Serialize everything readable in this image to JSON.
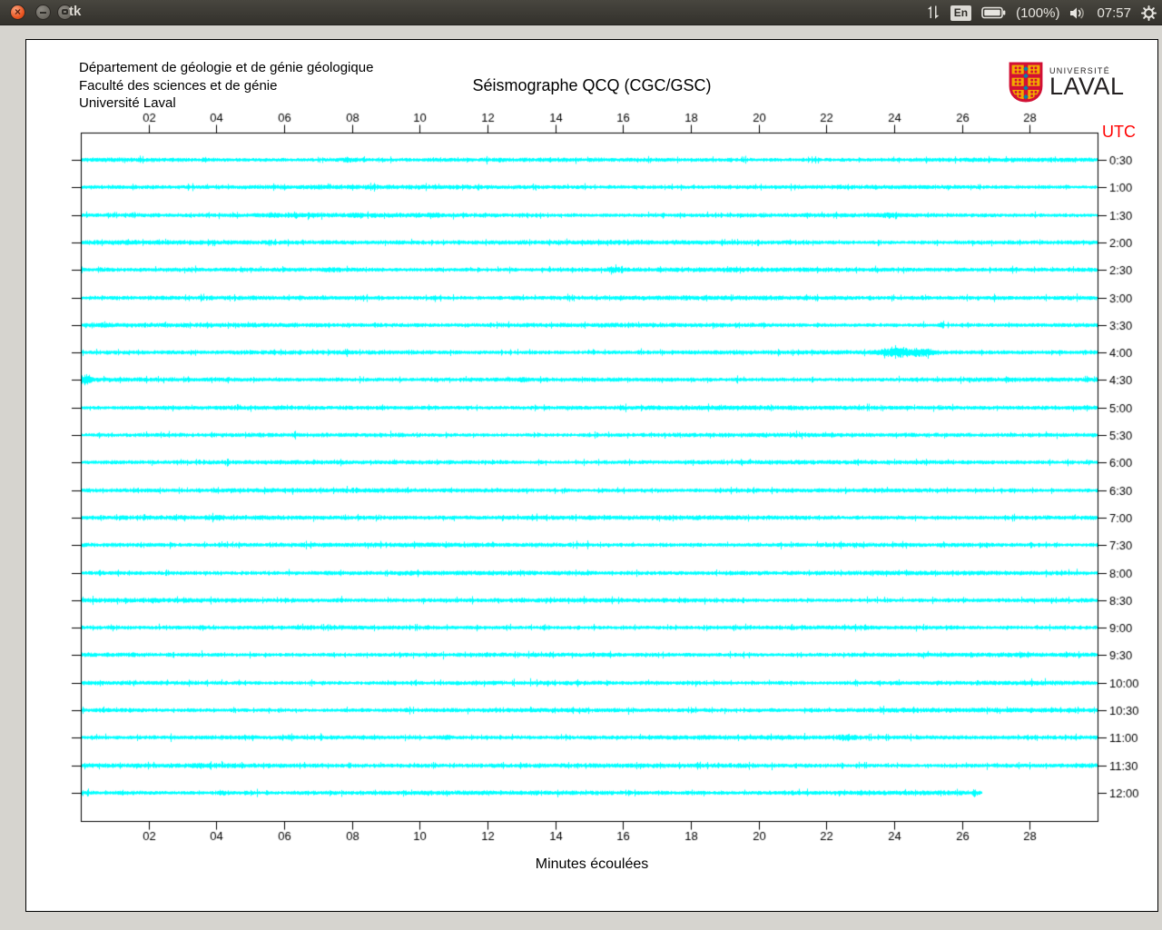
{
  "topbar": {
    "window_title": "tk",
    "window_buttons": {
      "close_glyph": "×"
    },
    "keyboard_layout": "En",
    "battery_percent": "(100%)",
    "clock": "07:57",
    "icons": {
      "network": "updown-arrows-icon",
      "battery": "battery-full-icon",
      "volume": "speaker-on-icon",
      "session": "gear-icon"
    }
  },
  "window": {
    "header_lines": [
      "Département de géologie et de génie géologique",
      "Faculté des sciences et de génie",
      "Université Laval"
    ],
    "title": "Séismographe QCQ (CGC/GSC)",
    "logo": {
      "line1": "UNIVERSITÉ",
      "line2": "LAVAL"
    },
    "utc_label": "UTC",
    "xlabel": "Minutes écoulées"
  },
  "colors": {
    "trace": "#00ffff",
    "utc_label": "#ff0000",
    "axis": "#000000",
    "close_button": "#e95420",
    "logo_red": "#d21034",
    "logo_gold": "#f2a900",
    "logo_blue": "#0085ad",
    "topbar_bg": "#3c3a35",
    "desktop_bg": "#d6d4cf"
  },
  "chart_data": {
    "type": "line",
    "title": "Séismographe QCQ (CGC/GSC)",
    "xlabel": "Minutes écoulées",
    "ylabel_right": "UTC",
    "x_range_minutes": [
      0,
      30
    ],
    "x_ticks": [
      "02",
      "04",
      "06",
      "08",
      "10",
      "12",
      "14",
      "16",
      "18",
      "20",
      "22",
      "24",
      "26",
      "28"
    ],
    "x_tick_minutes": [
      2,
      4,
      6,
      8,
      10,
      12,
      14,
      16,
      18,
      20,
      22,
      24,
      26,
      28
    ],
    "row_interval_minutes": 30,
    "trace_color": "#00ffff",
    "grid": false,
    "rows": [
      {
        "label": "0:30",
        "length_min": 30,
        "events": [
          {
            "min": 7.9,
            "width": 0.5,
            "amp": 1.6
          }
        ]
      },
      {
        "label": "1:00",
        "length_min": 30,
        "events": []
      },
      {
        "label": "1:30",
        "length_min": 30,
        "events": [
          {
            "min": 5.7,
            "width": 0.3,
            "amp": 1.2
          },
          {
            "min": 8.1,
            "width": 0.3,
            "amp": 1.3
          },
          {
            "min": 10.4,
            "width": 0.25,
            "amp": 1.5
          },
          {
            "min": 23.8,
            "width": 0.4,
            "amp": 1.3
          }
        ]
      },
      {
        "label": "2:00",
        "length_min": 30,
        "events": []
      },
      {
        "label": "2:30",
        "length_min": 30,
        "events": [
          {
            "min": 7.4,
            "width": 0.3,
            "amp": 1.2
          },
          {
            "min": 15.7,
            "width": 0.3,
            "amp": 1.4
          }
        ]
      },
      {
        "label": "3:00",
        "length_min": 30,
        "events": []
      },
      {
        "label": "3:30",
        "length_min": 30,
        "events": []
      },
      {
        "label": "4:00",
        "length_min": 30,
        "events": [
          {
            "min": 24.1,
            "width": 0.8,
            "amp": 6
          },
          {
            "min": 24.9,
            "width": 0.5,
            "amp": 3.5
          }
        ]
      },
      {
        "label": "4:30",
        "length_min": 30,
        "events": [
          {
            "min": 0.15,
            "width": 0.2,
            "amp": 5
          },
          {
            "min": 13.0,
            "width": 0.3,
            "amp": 1.2
          }
        ]
      },
      {
        "label": "5:00",
        "length_min": 30,
        "events": []
      },
      {
        "label": "5:30",
        "length_min": 30,
        "events": []
      },
      {
        "label": "6:00",
        "length_min": 30,
        "events": []
      },
      {
        "label": "6:30",
        "length_min": 30,
        "events": []
      },
      {
        "label": "7:00",
        "length_min": 30,
        "events": [
          {
            "min": 4.0,
            "width": 0.3,
            "amp": 1.1
          }
        ]
      },
      {
        "label": "7:30",
        "length_min": 30,
        "events": []
      },
      {
        "label": "8:00",
        "length_min": 30,
        "events": []
      },
      {
        "label": "8:30",
        "length_min": 30,
        "events": []
      },
      {
        "label": "9:00",
        "length_min": 30,
        "events": []
      },
      {
        "label": "9:30",
        "length_min": 30,
        "events": []
      },
      {
        "label": "10:00",
        "length_min": 30,
        "events": []
      },
      {
        "label": "10:30",
        "length_min": 30,
        "events": []
      },
      {
        "label": "11:00",
        "length_min": 30,
        "events": [
          {
            "min": 10.7,
            "width": 0.3,
            "amp": 1.6
          },
          {
            "min": 22.6,
            "width": 0.35,
            "amp": 2.0
          }
        ]
      },
      {
        "label": "11:30",
        "length_min": 30,
        "events": [
          {
            "min": 3.5,
            "width": 0.3,
            "amp": 1.2
          }
        ]
      },
      {
        "label": "12:00",
        "length_min": 26.6,
        "events": [
          {
            "min": 4.2,
            "width": 0.3,
            "amp": 1.3
          }
        ]
      }
    ]
  }
}
